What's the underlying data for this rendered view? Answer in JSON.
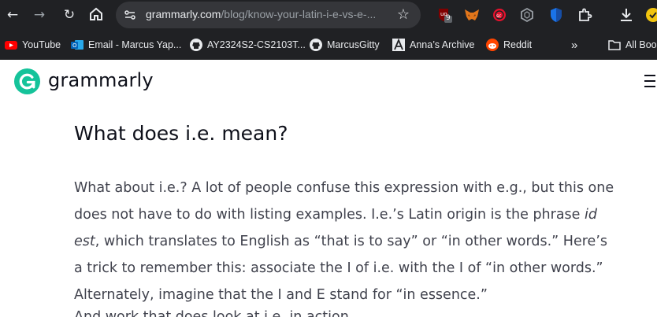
{
  "browser": {
    "url_host": "grammarly.com",
    "url_path": "/blog/know-your-latin-i-e-vs-e-...",
    "extensions": [
      {
        "name": "ublock-origin-icon",
        "badge": "9"
      },
      {
        "name": "metamask-icon"
      },
      {
        "name": "screen-recorder-icon"
      },
      {
        "name": "hexagon-extension-icon"
      },
      {
        "name": "shield-icon"
      },
      {
        "name": "puzzle-icon"
      },
      {
        "name": "download-icon"
      },
      {
        "name": "profile-icon"
      }
    ],
    "bookmarks": [
      {
        "label": "YouTube",
        "icon": "youtube-icon"
      },
      {
        "label": "Email - Marcus Yap...",
        "icon": "outlook-icon"
      },
      {
        "label": "AY2324S2-CS2103T...",
        "icon": "github-icon"
      },
      {
        "label": "MarcusGitty",
        "icon": "github-icon"
      },
      {
        "label": "Anna’s Archive",
        "icon": "annas-archive-icon"
      },
      {
        "label": "Reddit",
        "icon": "reddit-icon"
      },
      {
        "label": "All Boo",
        "icon": "folder-icon"
      }
    ],
    "overflow_label": "»"
  },
  "site": {
    "logo_text": "grammarly",
    "brand_color": "#15c39a"
  },
  "article": {
    "heading": "What does i.e. mean?",
    "p1_a": "What about i.e.? A lot of people confuse this expression with e.g., but this one does not have to do with listing examples. I.e.’s Latin origin is the phrase ",
    "p1_em": "id est",
    "p1_b": ", which translates to English as “that is to say” or “in other words.” Here’s a trick to remember this: associate the I of i.e. with the I of “in other words.” Alternately, imagine that the I and E stand for “in essence.”",
    "cut_text": "And work that does look at i.e. in action."
  }
}
